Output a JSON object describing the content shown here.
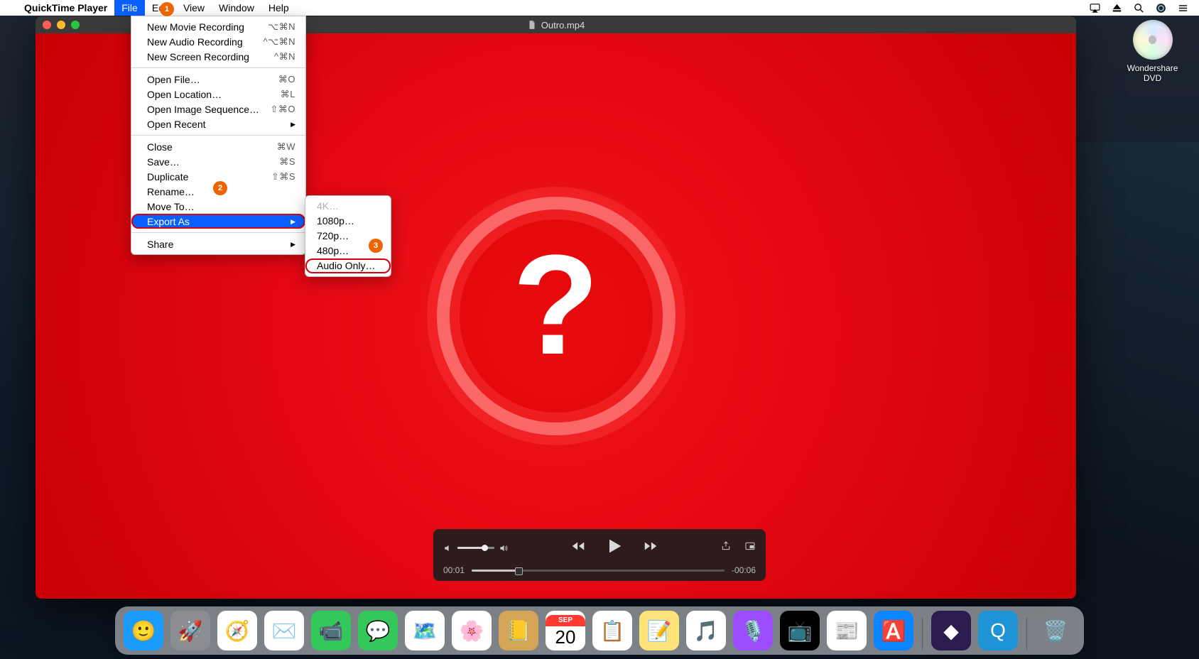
{
  "menubar": {
    "app_name": "QuickTime Player",
    "items": [
      "File",
      "Edit",
      "View",
      "Window",
      "Help"
    ],
    "selected": "File"
  },
  "menubar_right_icons": [
    "airplay",
    "eject",
    "search",
    "siri",
    "control-center"
  ],
  "file_menu": {
    "groups": [
      [
        {
          "label": "New Movie Recording",
          "shortcut": "⌥⌘N"
        },
        {
          "label": "New Audio Recording",
          "shortcut": "^⌥⌘N"
        },
        {
          "label": "New Screen Recording",
          "shortcut": "^⌘N"
        }
      ],
      [
        {
          "label": "Open File…",
          "shortcut": "⌘O"
        },
        {
          "label": "Open Location…",
          "shortcut": "⌘L"
        },
        {
          "label": "Open Image Sequence…",
          "shortcut": "⇧⌘O"
        },
        {
          "label": "Open Recent",
          "shortcut": "",
          "submenu": true
        }
      ],
      [
        {
          "label": "Close",
          "shortcut": "⌘W"
        },
        {
          "label": "Save…",
          "shortcut": "⌘S"
        },
        {
          "label": "Duplicate",
          "shortcut": "⇧⌘S"
        },
        {
          "label": "Rename…",
          "shortcut": ""
        },
        {
          "label": "Move To…",
          "shortcut": ""
        },
        {
          "label": "Export As",
          "shortcut": "",
          "submenu": true,
          "highlight": true,
          "red_ring": true
        }
      ],
      [
        {
          "label": "Share",
          "shortcut": "",
          "submenu": true
        }
      ]
    ]
  },
  "export_submenu": [
    {
      "label": "4K…",
      "disabled": true
    },
    {
      "label": "1080p…"
    },
    {
      "label": "720p…"
    },
    {
      "label": "480p…"
    },
    {
      "label": "Audio Only…",
      "red_ring": true
    }
  ],
  "annotations": {
    "1": "1",
    "2": "2",
    "3": "3"
  },
  "window": {
    "title": "Outro.mp4"
  },
  "player": {
    "elapsed": "00:01",
    "remaining": "-00:06"
  },
  "desktop_item": {
    "label": "Wondershare DVD"
  },
  "dock": {
    "apps": [
      {
        "name": "finder",
        "bg": "#1a9cff",
        "glyph": "🙂"
      },
      {
        "name": "launchpad",
        "bg": "#8c8c93",
        "glyph": "🚀"
      },
      {
        "name": "safari",
        "bg": "#ffffff",
        "glyph": "🧭"
      },
      {
        "name": "mail",
        "bg": "#ffffff",
        "glyph": "✉️"
      },
      {
        "name": "facetime",
        "bg": "#34c759",
        "glyph": "📹"
      },
      {
        "name": "messages",
        "bg": "#34c759",
        "glyph": "💬"
      },
      {
        "name": "maps",
        "bg": "#ffffff",
        "glyph": "🗺️"
      },
      {
        "name": "photos",
        "bg": "#ffffff",
        "glyph": "🌸"
      },
      {
        "name": "contacts",
        "bg": "#d4a556",
        "glyph": "📒"
      },
      {
        "name": "calendar",
        "bg": "#ffffff",
        "glyph": "📅"
      },
      {
        "name": "reminders",
        "bg": "#ffffff",
        "glyph": "📋"
      },
      {
        "name": "notes",
        "bg": "#ffe27a",
        "glyph": "📝"
      },
      {
        "name": "music",
        "bg": "#ffffff",
        "glyph": "🎵"
      },
      {
        "name": "podcasts",
        "bg": "#9b4dff",
        "glyph": "🎙️"
      },
      {
        "name": "tv",
        "bg": "#000000",
        "glyph": "📺"
      },
      {
        "name": "news",
        "bg": "#ffffff",
        "glyph": "📰"
      },
      {
        "name": "appstore",
        "bg": "#0a84ff",
        "glyph": "🅰️"
      }
    ],
    "extra": [
      {
        "name": "uniconv",
        "bg": "#2b1b4e",
        "glyph": "◆"
      },
      {
        "name": "quicktime",
        "bg": "#1e94d6",
        "glyph": "Q"
      }
    ],
    "trash": {
      "name": "trash",
      "bg": "transparent",
      "glyph": "🗑️"
    },
    "calendar_month": "SEP",
    "calendar_day": "20"
  }
}
